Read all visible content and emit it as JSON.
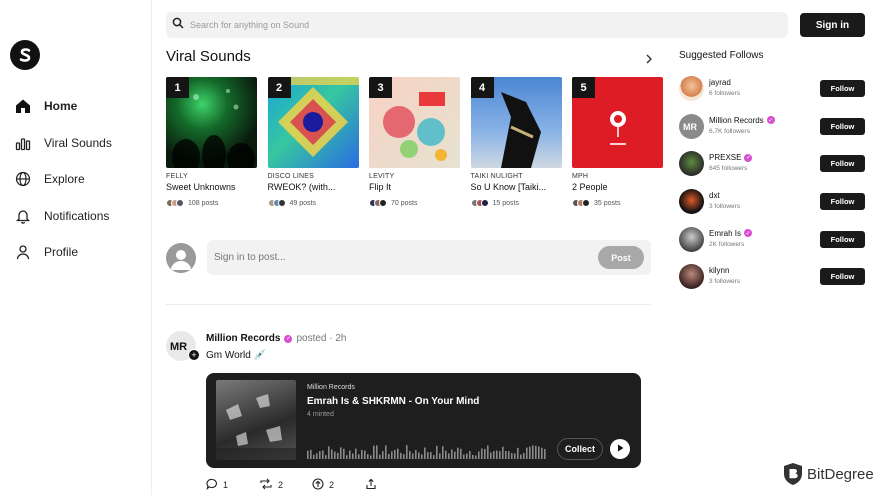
{
  "app": {
    "logo_letter": "S"
  },
  "sidebar": {
    "items": [
      {
        "label": "Home",
        "icon": "home-icon",
        "active": true
      },
      {
        "label": "Viral Sounds",
        "icon": "chart-bars-icon"
      },
      {
        "label": "Explore",
        "icon": "globe-icon"
      },
      {
        "label": "Notifications",
        "icon": "bell-icon"
      },
      {
        "label": "Profile",
        "icon": "user-icon"
      }
    ]
  },
  "search": {
    "placeholder": "Search for anything on Sound"
  },
  "header": {
    "signin_label": "Sign in"
  },
  "viral": {
    "title": "Viral Sounds",
    "cards": [
      {
        "rank": "1",
        "artist": "FELLY",
        "track": "Sweet Unknowns",
        "posts": "108 posts"
      },
      {
        "rank": "2",
        "artist": "DISCO LINES",
        "track": "RWEOK? (with...",
        "posts": "49 posts"
      },
      {
        "rank": "3",
        "artist": "LEVITY",
        "track": "Flip It",
        "posts": "70 posts"
      },
      {
        "rank": "4",
        "artist": "TAIKI NULIGHT",
        "track": "So U Know [Taiki...",
        "posts": "15 posts"
      },
      {
        "rank": "5",
        "artist": "MPH",
        "track": "2 People",
        "posts": "35 posts"
      }
    ]
  },
  "composer": {
    "placeholder": "Sign in to post...",
    "post_label": "Post"
  },
  "feed": {
    "post": {
      "author": "Million Records",
      "meta": "posted · 2h",
      "text": "Gm World 💉",
      "player": {
        "label": "Million Records",
        "title": "Emrah Is & SHKRMN - On Your Mind",
        "minted": "4 minted",
        "collect_label": "Collect"
      },
      "actions": {
        "comments": "1",
        "reposts": "2",
        "upvotes": "2"
      }
    }
  },
  "suggested": {
    "title": "Suggested Follows",
    "follow_label": "Follow",
    "items": [
      {
        "name": "jayrad",
        "followers": "6 followers",
        "verified": false
      },
      {
        "name": "Million Records",
        "followers": "6.7K followers",
        "verified": true
      },
      {
        "name": "PREXSE",
        "followers": "645 followers",
        "verified": true
      },
      {
        "name": "dxt",
        "followers": "3 followers",
        "verified": false
      },
      {
        "name": "Emrah Is",
        "followers": "2K followers",
        "verified": true
      },
      {
        "name": "kilynn",
        "followers": "3 followers",
        "verified": false
      }
    ]
  },
  "watermark": {
    "text": "BitDegree"
  }
}
